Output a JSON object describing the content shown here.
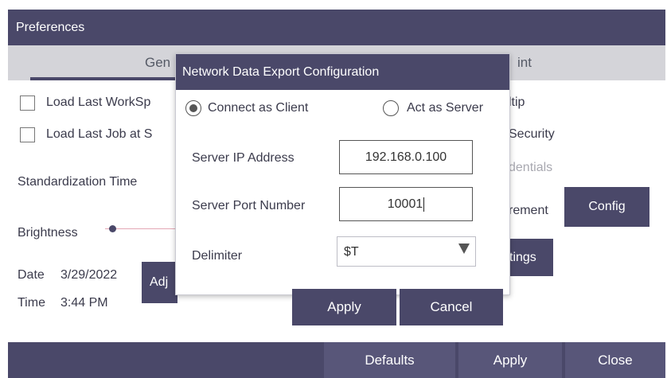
{
  "window": {
    "title": "Preferences"
  },
  "tabs": [
    {
      "label": "Gen"
    },
    {
      "label": "int"
    }
  ],
  "general": {
    "load_last_workspace": "Load Last WorkSp",
    "load_last_job": "Load Last Job at S",
    "standardization_time": "Standardization Time",
    "brightness": "Brightness",
    "date_label": "Date",
    "date_value": "3/29/2022",
    "time_label": "Time",
    "time_value": "3:44 PM",
    "adjust_button": "Adj"
  },
  "right_panel": {
    "tooltip": "ltip",
    "security": "Security",
    "credentials": "dentials",
    "measurement": "rement",
    "config_button": "Config",
    "settings_button": "tings"
  },
  "bottom_bar": {
    "defaults": "Defaults",
    "apply": "Apply",
    "close": "Close"
  },
  "dialog": {
    "title": "Network Data Export Configuration",
    "mode_client": "Connect as Client",
    "mode_server": "Act as Server",
    "selected_mode": "client",
    "ip_label": "Server IP Address",
    "ip_value": "192.168.0.100",
    "port_label": "Server Port Number",
    "port_value": "10001",
    "delimiter_label": "Delimiter",
    "delimiter_value": "$T",
    "apply": "Apply",
    "cancel": "Cancel"
  },
  "colors": {
    "accent": "#4a4869",
    "tab_bar": "#d4d4d9",
    "slider_track": "#e3a7b4"
  }
}
